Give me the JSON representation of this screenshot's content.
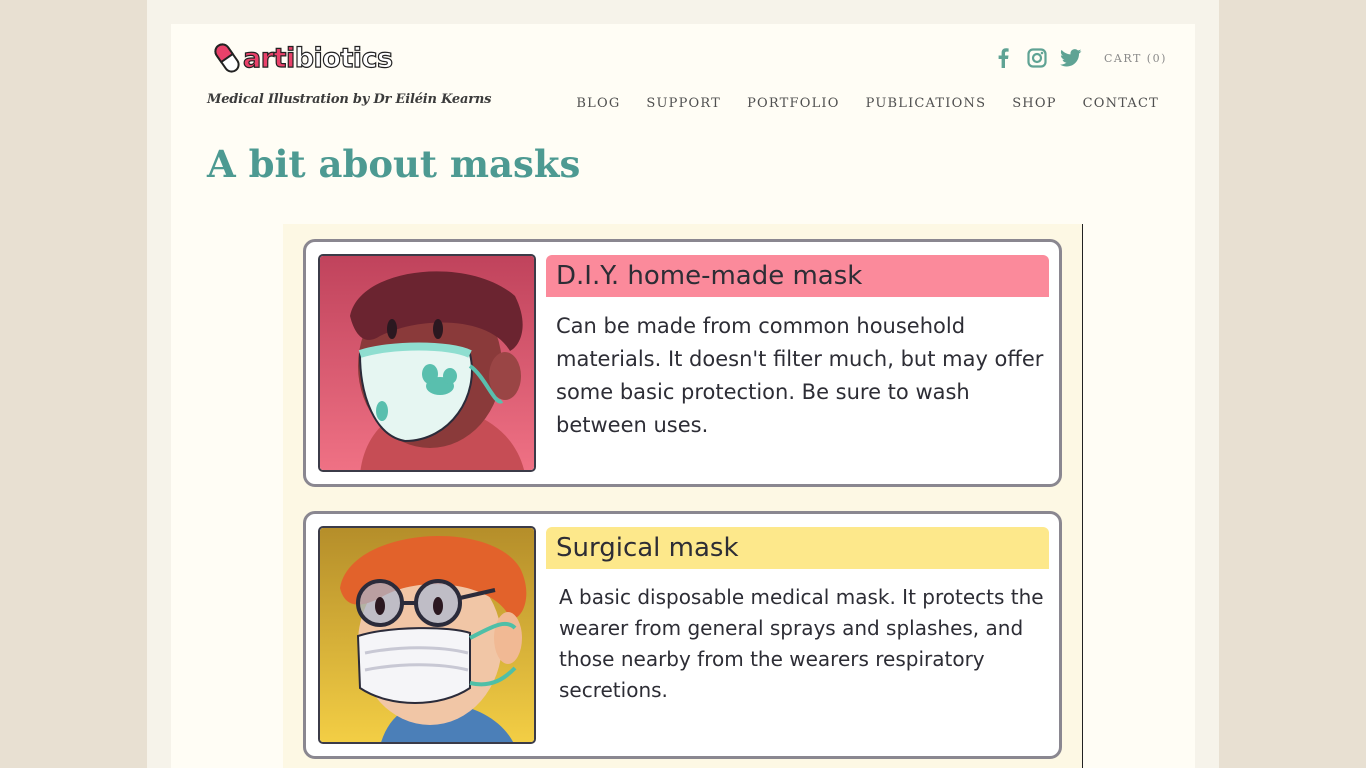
{
  "site": {
    "logo_part1": "arti",
    "logo_part2": "biotics",
    "tagline": "Medical Illustration by Dr Eiléin Kearns",
    "cart": "CART (0)"
  },
  "social": [
    {
      "icon": "facebook-icon"
    },
    {
      "icon": "instagram-icon"
    },
    {
      "icon": "twitter-icon"
    }
  ],
  "nav": {
    "blog": "BLOG",
    "support": "SUPPORT",
    "portfolio": "PORTFOLIO",
    "publications": "PUBLICATIONS",
    "shop": "SHOP",
    "contact": "CONTACT"
  },
  "page": {
    "title": "A bit about masks"
  },
  "masks": [
    {
      "heading": "D.I.Y. home-made mask",
      "text": "Can be made from common household materials. It doesn't filter much, but may offer some basic protection. Be sure to wash between uses."
    },
    {
      "heading": "Surgical mask",
      "text": "A basic disposable medical mask. It protects the wearer from general sprays and splashes, and those nearby from the wearers respiratory secretions."
    }
  ],
  "colors": {
    "accent": "#4d9a92",
    "social": "#5fa394",
    "diy_header": "#fb8a9b",
    "surgical_header": "#fde88b"
  }
}
